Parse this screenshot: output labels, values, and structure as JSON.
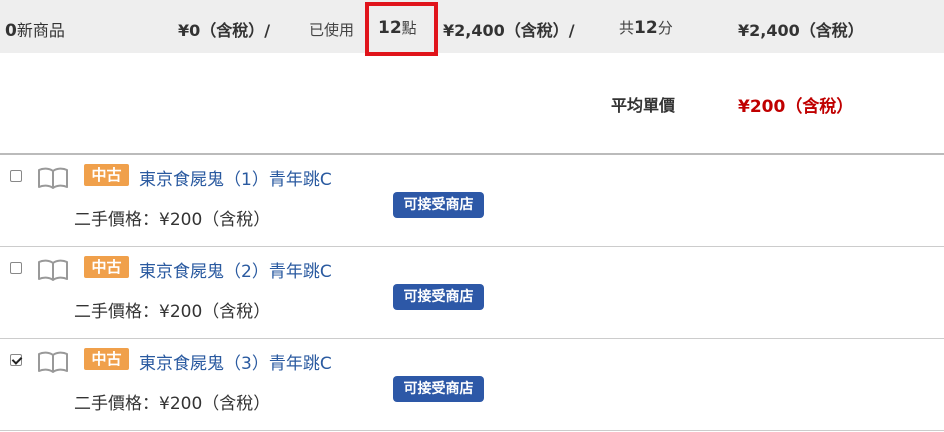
{
  "summary": {
    "new_count": "0",
    "new_label": "新商品",
    "new_price": "¥0（含稅）/",
    "used_label": "已使用",
    "used_count": "12",
    "used_unit": "點",
    "used_price": "¥2,400（含稅）/",
    "total_label": "共",
    "total_count": "12",
    "total_unit": "分",
    "total_price": "¥2,400（含稅）",
    "highlight_color": "#e0141b"
  },
  "average": {
    "label": "平均單價",
    "value": "¥200（含稅）"
  },
  "items": [
    {
      "checked": false,
      "condition": "中古",
      "title": "東京食屍鬼（1）青年跳C",
      "price": "二手價格：¥200（含稅）",
      "store_button": "可接受商店"
    },
    {
      "checked": false,
      "condition": "中古",
      "title": "東京食屍鬼（2）青年跳C",
      "price": "二手價格：¥200（含稅）",
      "store_button": "可接受商店"
    },
    {
      "checked": true,
      "condition": "中古",
      "title": "東京食屍鬼（3）青年跳C",
      "price": "二手價格：¥200（含稅）",
      "store_button": "可接受商店"
    }
  ],
  "icons": {
    "book": "book-icon",
    "checkbox": "checkbox"
  },
  "colors": {
    "badge": "#f0a04b",
    "store_button": "#2d58a7",
    "avg_price": "#c00000",
    "title_link": "#2a5aa0"
  }
}
